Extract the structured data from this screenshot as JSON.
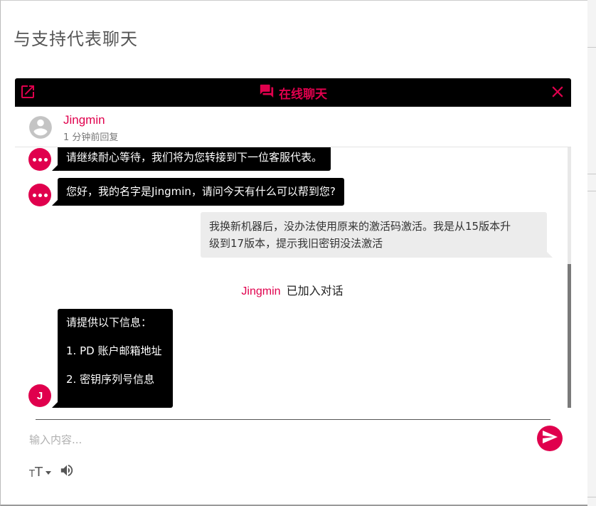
{
  "modal": {
    "title": "与支持代表聊天"
  },
  "chat_header": {
    "title": "在线聊天",
    "popout_icon": "external-link-icon",
    "close_icon": "close-icon",
    "chat_icon": "forum-icon"
  },
  "agent": {
    "name": "Jingmin",
    "status": "1 分钟前回复",
    "avatar_icon": "user-avatar-icon"
  },
  "messages": [
    {
      "from": "agent",
      "avatar": "typing-dots",
      "text": "请继续耐心等待，我们将为您转接到下一位客服代表。"
    },
    {
      "from": "agent",
      "avatar": "typing-dots",
      "text": "您好，我的名字是Jingmin，请问今天有什么可以帮到您?"
    },
    {
      "from": "user",
      "lines": [
        "我换新机器后，没办法使用原来的激活码激活。我是从15版本升",
        "级到17版本，提示我旧密钥没法激活"
      ]
    },
    {
      "from": "system",
      "name": "Jingmin",
      "text": "已加入对话"
    },
    {
      "from": "agent",
      "avatar_letter": "J",
      "lines": [
        "请提供以下信息：",
        "1. PD 账户邮箱地址",
        "2. 密钥序列号信息"
      ]
    }
  ],
  "composer": {
    "placeholder": "输入内容...",
    "send_icon": "send-icon",
    "font_size_label_small": "T",
    "font_size_label_big": "T",
    "sound_icon": "volume-icon"
  },
  "colors": {
    "accent": "#e0004d",
    "header_bg": "#000000",
    "user_bubble": "#ececec"
  }
}
